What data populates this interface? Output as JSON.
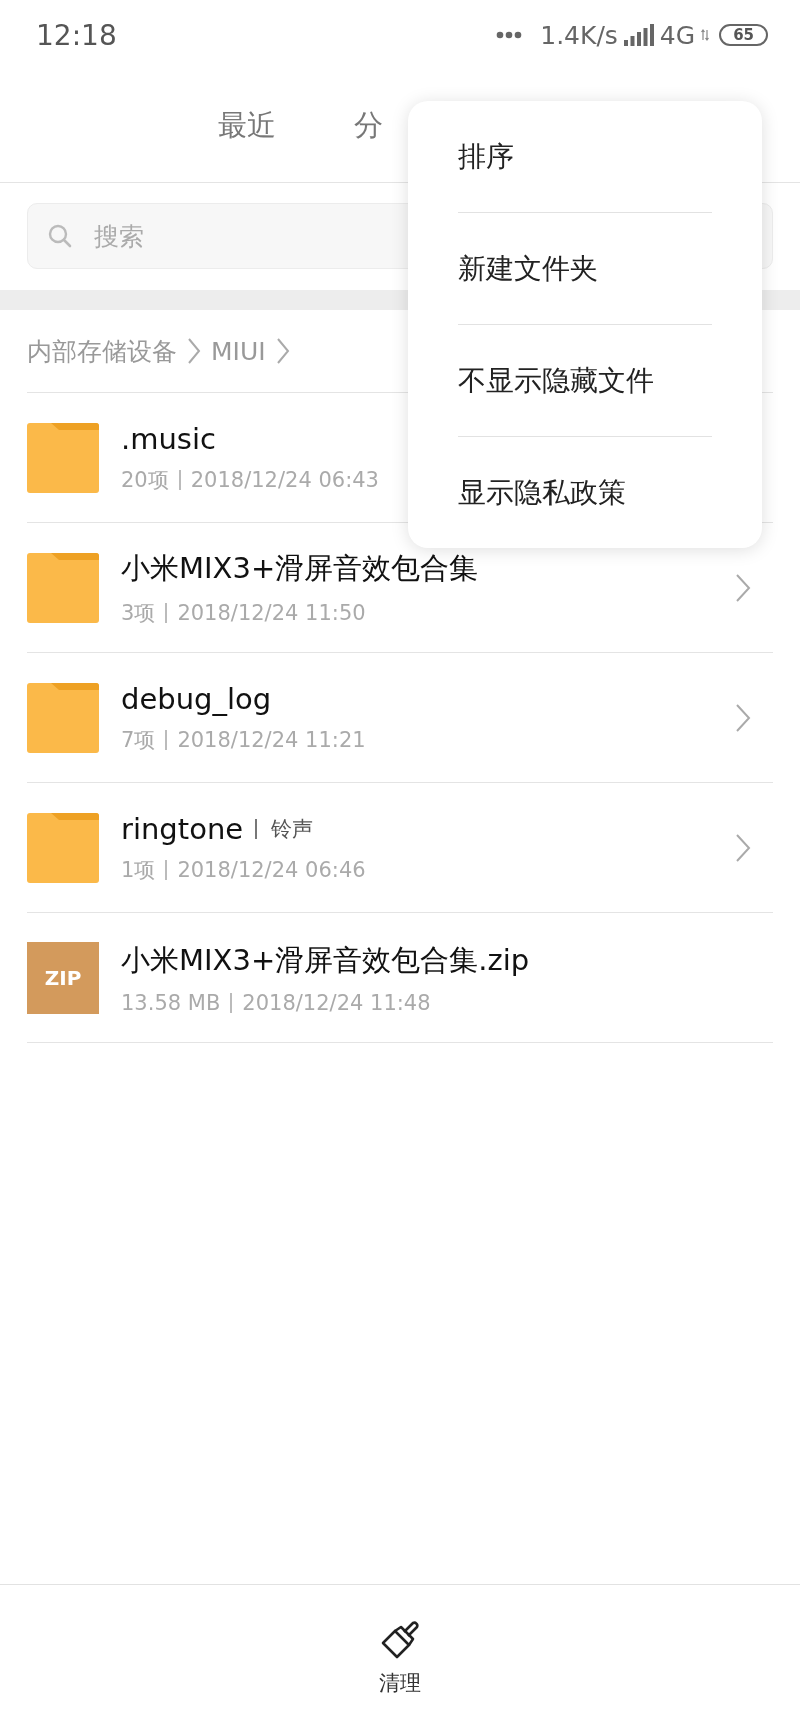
{
  "status_bar": {
    "time": "12:18",
    "speed": "1.4K/s",
    "network": "4G",
    "battery": "65"
  },
  "tabs": [
    {
      "label": "最近"
    },
    {
      "label": "分"
    }
  ],
  "search": {
    "placeholder": "搜索"
  },
  "breadcrumb": [
    "内部存储设备",
    "MIUI"
  ],
  "files": [
    {
      "kind": "folder",
      "name": ".music",
      "count": "20项",
      "date": "2018/12/24 06:43",
      "chevron": false
    },
    {
      "kind": "folder",
      "name": "小米MIX3+滑屏音效包合集",
      "count": "3项",
      "date": "2018/12/24 11:50",
      "chevron": true
    },
    {
      "kind": "folder",
      "name": "debug_log",
      "count": "7项",
      "date": "2018/12/24 11:21",
      "chevron": true
    },
    {
      "kind": "folder",
      "name": "ringtone",
      "tag": "铃声",
      "count": "1项",
      "date": "2018/12/24 06:46",
      "chevron": true
    },
    {
      "kind": "zip",
      "name": "小米MIX3+滑屏音效包合集.zip",
      "icon_label": "ZIP",
      "count": "13.58 MB",
      "date": "2018/12/24 11:48",
      "chevron": false
    }
  ],
  "menu": [
    "排序",
    "新建文件夹",
    "不显示隐藏文件",
    "显示隐私政策"
  ],
  "bottom_bar": {
    "label": "清理"
  }
}
